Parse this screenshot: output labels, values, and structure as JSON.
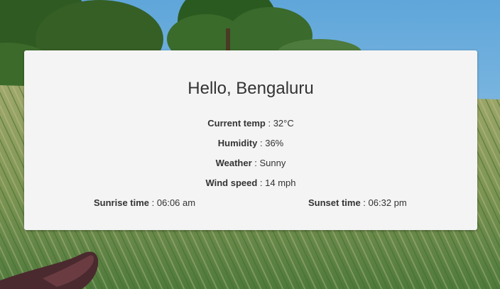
{
  "greeting": "Hello, Bengaluru",
  "weather": {
    "current_temp_label": "Current temp",
    "current_temp_value": "32°C",
    "humidity_label": "Humidity",
    "humidity_value": "36%",
    "weather_label": "Weather",
    "weather_value": "Sunny",
    "wind_label": "Wind speed",
    "wind_value": "14 mph",
    "sunrise_label": "Sunrise time",
    "sunrise_value": "06:06 am",
    "sunset_label": "Sunset time",
    "sunset_value": "06:32 pm"
  },
  "separator": " : "
}
